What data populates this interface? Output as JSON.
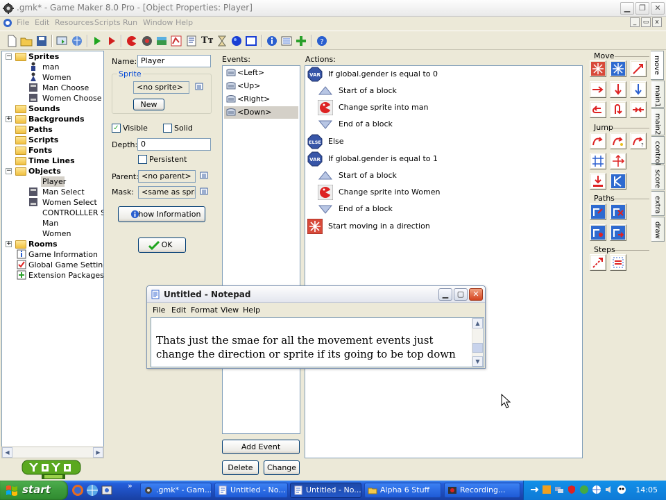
{
  "window": {
    "title": ".gmk* - Game Maker 8.0 Pro - [Object Properties: Player]"
  },
  "menu": [
    "File",
    "Edit",
    "Resources",
    "Scripts",
    "Run",
    "Window",
    "Help"
  ],
  "tree": {
    "items": [
      {
        "label": "Sprites",
        "bold": true
      },
      {
        "label": "man"
      },
      {
        "label": "Women"
      },
      {
        "label": "Man Choose"
      },
      {
        "label": "Women Choose"
      },
      {
        "label": "Sounds",
        "bold": true
      },
      {
        "label": "Backgrounds",
        "bold": true
      },
      {
        "label": "Paths",
        "bold": true
      },
      {
        "label": "Scripts",
        "bold": true
      },
      {
        "label": "Fonts",
        "bold": true
      },
      {
        "label": "Time Lines",
        "bold": true
      },
      {
        "label": "Objects",
        "bold": true
      },
      {
        "label": "Player"
      },
      {
        "label": "Man Select"
      },
      {
        "label": "Women Select"
      },
      {
        "label": "CONTROLLLER ST"
      },
      {
        "label": "Man"
      },
      {
        "label": "Women"
      },
      {
        "label": "Rooms",
        "bold": true
      },
      {
        "label": "Game Information"
      },
      {
        "label": "Global Game Settings"
      },
      {
        "label": "Extension Packages"
      }
    ]
  },
  "props": {
    "name_label": "Name:",
    "name_value": "Player",
    "sprite_group": "Sprite",
    "sprite_value": "<no sprite>",
    "new_button": "New",
    "visible_label": "Visible",
    "solid_label": "Solid",
    "depth_label": "Depth:",
    "depth_value": "0",
    "persistent_label": "Persistent",
    "parent_label": "Parent:",
    "parent_value": "<no parent>",
    "mask_label": "Mask:",
    "mask_value": "<same as sprite>",
    "show_info_button": "Show Information",
    "ok_button": "OK"
  },
  "events": {
    "label": "Events:",
    "items": [
      "<Left>",
      "<Up>",
      "<Right>",
      "<Down>"
    ],
    "selected": "<Down>",
    "add_button": "Add Event",
    "delete_button": "Delete",
    "change_button": "Change"
  },
  "actions": {
    "label": "Actions:",
    "items": [
      {
        "icon": "var",
        "text": "If global.gender is equal to 0",
        "indent": 0
      },
      {
        "icon": "start-block",
        "text": "Start of a block",
        "indent": 1
      },
      {
        "icon": "change-sprite",
        "text": "Change sprite into man",
        "indent": 1
      },
      {
        "icon": "end-block",
        "text": "End of a block",
        "indent": 1
      },
      {
        "icon": "else",
        "text": "Else",
        "indent": 0
      },
      {
        "icon": "var",
        "text": "If global.gender is equal to 1",
        "indent": 0
      },
      {
        "icon": "start-block",
        "text": "Start of a block",
        "indent": 1
      },
      {
        "icon": "change-sprite",
        "text": "Change sprite into Women",
        "indent": 1
      },
      {
        "icon": "end-block",
        "text": "End of a block",
        "indent": 1
      },
      {
        "icon": "move-fixed",
        "text": "Start moving in a direction",
        "indent": 0
      }
    ]
  },
  "palette": {
    "sections": [
      "Move",
      "Jump",
      "Paths",
      "Steps"
    ],
    "tabs": [
      "move",
      "main1",
      "main2",
      "control",
      "score",
      "extra",
      "draw"
    ],
    "active_tab": "move"
  },
  "notepad": {
    "title": "Untitled - Notepad",
    "menu": [
      "File",
      "Edit",
      "Format",
      "View",
      "Help"
    ],
    "text": "Thats just the smae for all the movement events just change the direction or sprite if its going to be top down"
  },
  "taskbar": {
    "start": "start",
    "tasks": [
      {
        "label": ".gmk* - Gam...",
        "active": false
      },
      {
        "label": "Untitled - No...",
        "active": false
      },
      {
        "label": "Untitled - No...",
        "active": true
      },
      {
        "label": "Alpha 6 Stuff",
        "active": false
      },
      {
        "label": "Recording...",
        "active": false
      }
    ],
    "clock": "14:05"
  },
  "colors": {
    "selection": "#d4d0c8",
    "taskbar_blue": "#245edb",
    "start_green": "#3c9a3c",
    "tree_border": "#7f9db9"
  }
}
